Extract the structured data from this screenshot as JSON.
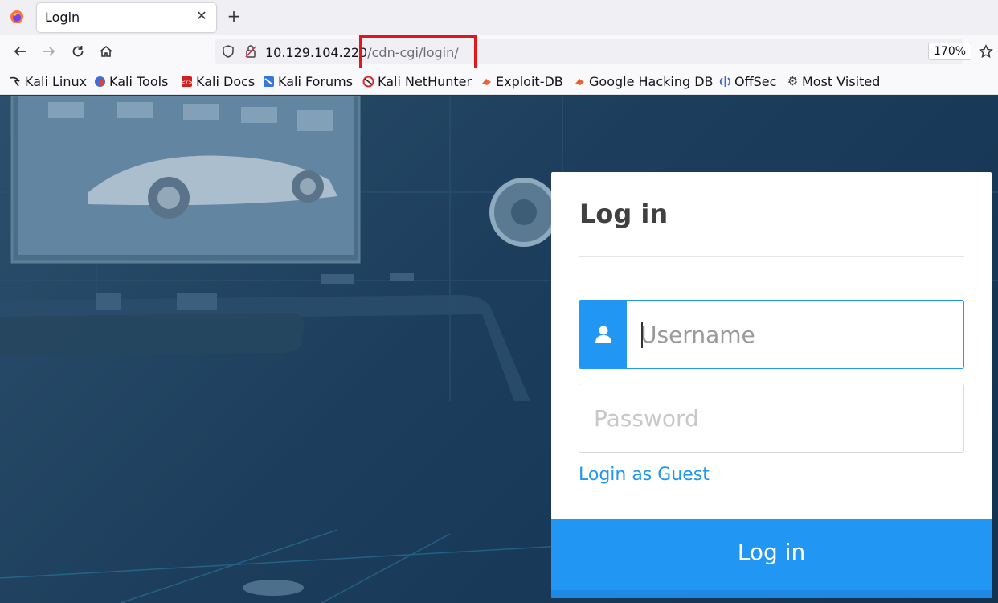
{
  "browser": {
    "tab": {
      "title": "Login",
      "close_icon": "close-icon"
    },
    "new_tab": "+",
    "url": {
      "host": "10.129.104.220",
      "path": "/cdn-cgi/login/"
    },
    "zoom": "170%"
  },
  "bookmarks": [
    {
      "label": "Kali Linux",
      "icon": "kali-dragon-icon"
    },
    {
      "label": "Kali Tools",
      "icon": "kali-tools-icon"
    },
    {
      "label": "Kali Docs",
      "icon": "kali-docs-icon"
    },
    {
      "label": "Kali Forums",
      "icon": "kali-forums-icon"
    },
    {
      "label": "Kali NetHunter",
      "icon": "nethunter-icon"
    },
    {
      "label": "Exploit-DB",
      "icon": "exploit-db-icon"
    },
    {
      "label": "Google Hacking DB",
      "icon": "ghdb-icon"
    },
    {
      "label": "OffSec",
      "icon": "offsec-icon"
    },
    {
      "label": "Most Visited",
      "icon": "gear-icon"
    }
  ],
  "login": {
    "title": "Log in",
    "username_placeholder": "Username",
    "password_placeholder": "Password",
    "guest_link": "Login as Guest",
    "submit_label": "Log in"
  },
  "colors": {
    "accent": "#2196f3",
    "highlight_box": "#e4161b",
    "background": "#1c3e5c"
  }
}
